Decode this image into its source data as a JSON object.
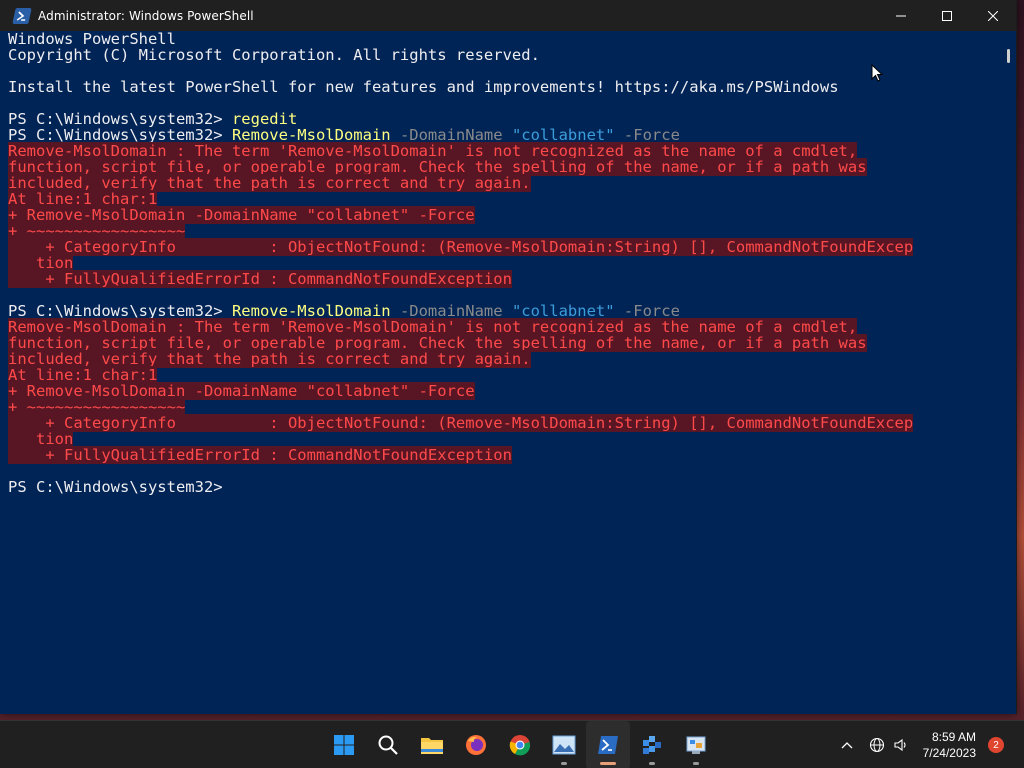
{
  "window": {
    "title": "Administrator: Windows PowerShell"
  },
  "console": {
    "lines": [
      {
        "parts": [
          {
            "t": "Windows PowerShell",
            "c": ""
          }
        ]
      },
      {
        "parts": [
          {
            "t": "Copyright (C) Microsoft Corporation. All rights reserved.",
            "c": ""
          }
        ]
      },
      {
        "parts": [
          {
            "t": "",
            "c": ""
          }
        ]
      },
      {
        "parts": [
          {
            "t": "Install the latest PowerShell for new features and improvements! https://aka.ms/PSWindows",
            "c": ""
          }
        ]
      },
      {
        "parts": [
          {
            "t": "",
            "c": ""
          }
        ]
      },
      {
        "parts": [
          {
            "t": "PS C:\\Windows\\system32> ",
            "c": ""
          },
          {
            "t": "regedit",
            "c": "cmd"
          }
        ]
      },
      {
        "parts": [
          {
            "t": "PS C:\\Windows\\system32> ",
            "c": ""
          },
          {
            "t": "Remove-MsolDomain",
            "c": "cmd"
          },
          {
            "t": " -DomainName ",
            "c": "param"
          },
          {
            "t": "\"collabnet\"",
            "c": "str"
          },
          {
            "t": " -Force",
            "c": "param"
          }
        ]
      },
      {
        "parts": [
          {
            "t": "Remove-MsolDomain : The term 'Remove-MsolDomain' is not recognized as the name of a cmdlet,",
            "c": "err"
          }
        ]
      },
      {
        "parts": [
          {
            "t": "function, script file, or operable program. Check the spelling of the name, or if a path was",
            "c": "err"
          }
        ]
      },
      {
        "parts": [
          {
            "t": "included, verify that the path is correct and try again.",
            "c": "err"
          }
        ]
      },
      {
        "parts": [
          {
            "t": "At line:1 char:1",
            "c": "err"
          }
        ]
      },
      {
        "parts": [
          {
            "t": "+ Remove-MsolDomain -DomainName \"collabnet\" -Force",
            "c": "err"
          }
        ]
      },
      {
        "parts": [
          {
            "t": "+ ~~~~~~~~~~~~~~~~~",
            "c": "err"
          }
        ]
      },
      {
        "parts": [
          {
            "t": "    + CategoryInfo          : ObjectNotFound: (Remove-MsolDomain:String) [], CommandNotFoundExcep",
            "c": "err"
          }
        ]
      },
      {
        "parts": [
          {
            "t": "   tion",
            "c": "err"
          }
        ]
      },
      {
        "parts": [
          {
            "t": "    + FullyQualifiedErrorId : CommandNotFoundException",
            "c": "err"
          }
        ]
      },
      {
        "parts": [
          {
            "t": "",
            "c": ""
          }
        ]
      },
      {
        "parts": [
          {
            "t": "PS C:\\Windows\\system32> ",
            "c": ""
          },
          {
            "t": "Remove-MsolDomain",
            "c": "cmd"
          },
          {
            "t": " -DomainName ",
            "c": "param"
          },
          {
            "t": "\"collabnet\"",
            "c": "str"
          },
          {
            "t": " -Force",
            "c": "param"
          }
        ]
      },
      {
        "parts": [
          {
            "t": "Remove-MsolDomain : The term 'Remove-MsolDomain' is not recognized as the name of a cmdlet,",
            "c": "err"
          }
        ]
      },
      {
        "parts": [
          {
            "t": "function, script file, or operable program. Check the spelling of the name, or if a path was",
            "c": "err"
          }
        ]
      },
      {
        "parts": [
          {
            "t": "included, verify that the path is correct and try again.",
            "c": "err"
          }
        ]
      },
      {
        "parts": [
          {
            "t": "At line:1 char:1",
            "c": "err"
          }
        ]
      },
      {
        "parts": [
          {
            "t": "+ Remove-MsolDomain -DomainName \"collabnet\" -Force",
            "c": "err"
          }
        ]
      },
      {
        "parts": [
          {
            "t": "+ ~~~~~~~~~~~~~~~~~",
            "c": "err"
          }
        ]
      },
      {
        "parts": [
          {
            "t": "    + CategoryInfo          : ObjectNotFound: (Remove-MsolDomain:String) [], CommandNotFoundExcep",
            "c": "err"
          }
        ]
      },
      {
        "parts": [
          {
            "t": "   tion",
            "c": "err"
          }
        ]
      },
      {
        "parts": [
          {
            "t": "    + FullyQualifiedErrorId : CommandNotFoundException",
            "c": "err"
          }
        ]
      },
      {
        "parts": [
          {
            "t": "",
            "c": ""
          }
        ]
      },
      {
        "parts": [
          {
            "t": "PS C:\\Windows\\system32> ",
            "c": ""
          }
        ]
      }
    ]
  },
  "taskbar": {
    "apps": [
      {
        "name": "start-button",
        "icon": "windows-logo-icon",
        "active": false,
        "running": false
      },
      {
        "name": "search-button",
        "icon": "search-icon",
        "active": false,
        "running": false
      },
      {
        "name": "taskbar-file-explorer",
        "icon": "folder-icon",
        "active": false,
        "running": false
      },
      {
        "name": "taskbar-firefox",
        "icon": "firefox-icon",
        "active": false,
        "running": false
      },
      {
        "name": "taskbar-chrome",
        "icon": "chrome-icon",
        "active": false,
        "running": false
      },
      {
        "name": "taskbar-photos",
        "icon": "photos-icon",
        "active": false,
        "running": true
      },
      {
        "name": "taskbar-powershell",
        "icon": "powershell-icon",
        "active": true,
        "running": true
      },
      {
        "name": "taskbar-regedit",
        "icon": "registry-editor-icon",
        "active": false,
        "running": true
      },
      {
        "name": "taskbar-control-panel",
        "icon": "control-panel-icon",
        "active": false,
        "running": true
      }
    ],
    "time": "8:59 AM",
    "date": "7/24/2023",
    "notification_count": "2"
  }
}
